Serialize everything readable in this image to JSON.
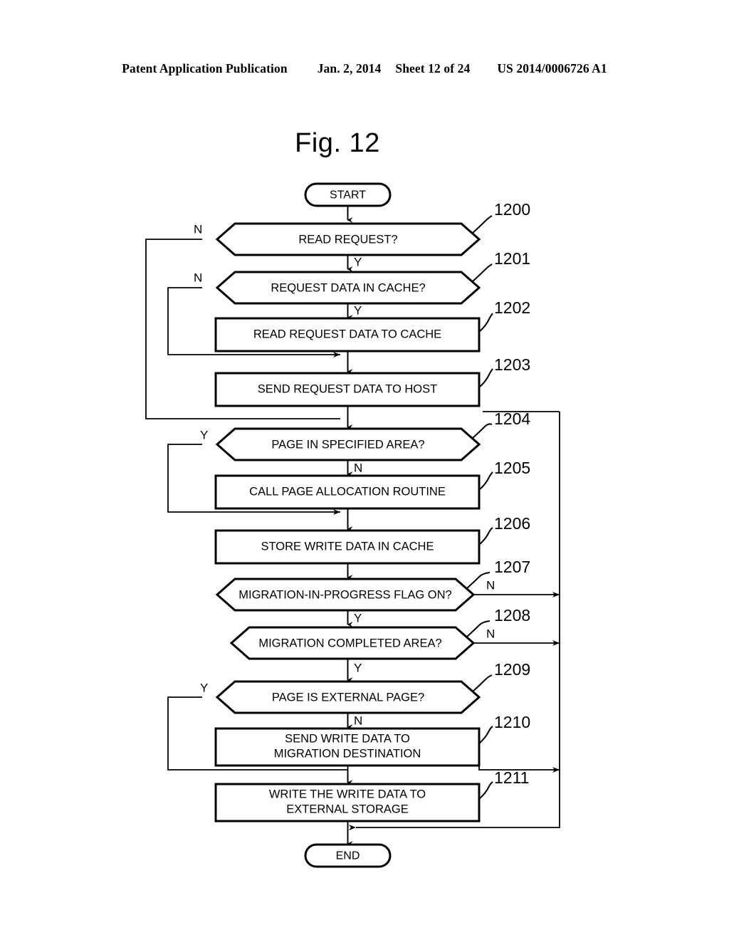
{
  "header": {
    "publication": "Patent Application Publication",
    "date": "Jan. 2, 2014",
    "sheet": "Sheet 12 of 24",
    "patent_number": "US 2014/0006726 A1"
  },
  "figure": {
    "title": "Fig. 12"
  },
  "flowchart": {
    "start_label": "START",
    "end_label": "END",
    "yes_label": "Y",
    "no_label": "N",
    "nodes": [
      {
        "ref": "1200",
        "type": "decision",
        "text": "READ REQUEST?"
      },
      {
        "ref": "1201",
        "type": "decision",
        "text": "REQUEST DATA IN CACHE?"
      },
      {
        "ref": "1202",
        "type": "process",
        "text": "READ REQUEST DATA TO CACHE"
      },
      {
        "ref": "1203",
        "type": "process",
        "text": "SEND REQUEST DATA TO HOST"
      },
      {
        "ref": "1204",
        "type": "decision",
        "text": "PAGE IN SPECIFIED AREA?"
      },
      {
        "ref": "1205",
        "type": "process",
        "text": "CALL PAGE ALLOCATION ROUTINE"
      },
      {
        "ref": "1206",
        "type": "process",
        "text": "STORE WRITE DATA IN CACHE"
      },
      {
        "ref": "1207",
        "type": "decision",
        "text": "MIGRATION-IN-PROGRESS FLAG ON?"
      },
      {
        "ref": "1208",
        "type": "decision",
        "text": "MIGRATION COMPLETED AREA?"
      },
      {
        "ref": "1209",
        "type": "decision",
        "text": "PAGE IS EXTERNAL PAGE?"
      },
      {
        "ref": "1210",
        "type": "process",
        "text_line1": "SEND WRITE DATA TO",
        "text_line2": "MIGRATION DESTINATION"
      },
      {
        "ref": "1211",
        "type": "process",
        "text_line1": "WRITE THE WRITE DATA TO",
        "text_line2": "EXTERNAL STORAGE"
      }
    ],
    "branch_labels": {
      "n1200": "N",
      "y1200": "Y",
      "n1201": "N",
      "y1201": "Y",
      "y1204": "Y",
      "n1204": "N",
      "n1207": "N",
      "y1207": "Y",
      "n1208": "N",
      "y1208": "Y",
      "y1209": "Y",
      "n1209": "N"
    }
  },
  "colors": {
    "ink": "#000000",
    "paper": "#ffffff"
  }
}
